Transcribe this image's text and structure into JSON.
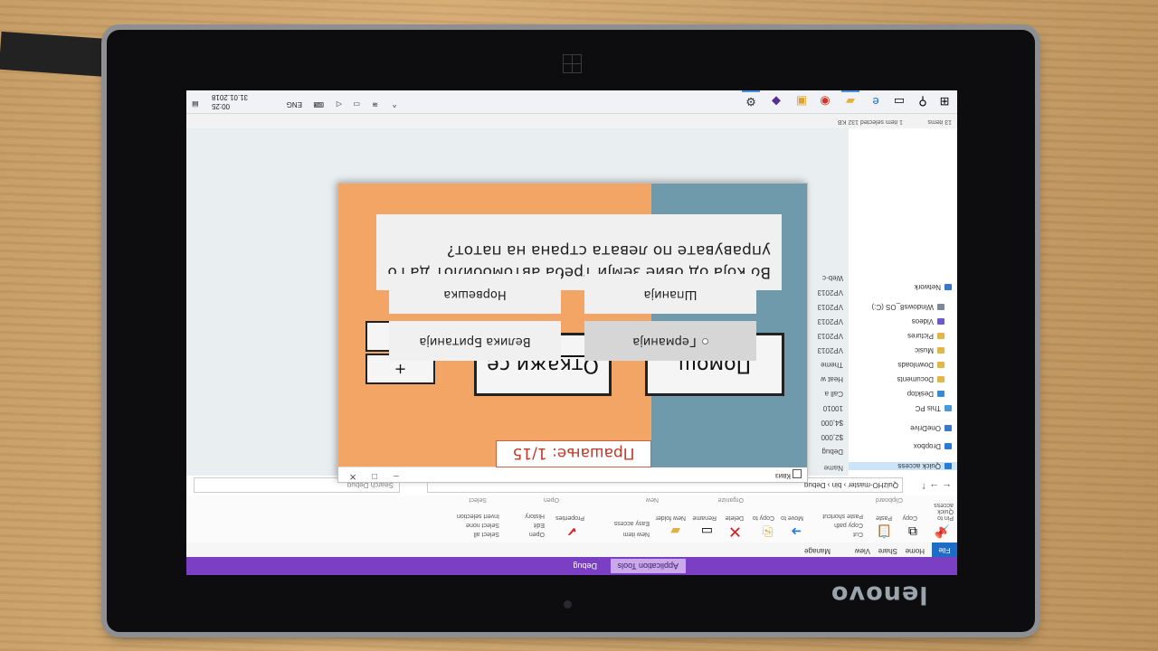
{
  "device": {
    "brand": "lenovo"
  },
  "explorer": {
    "title_tabs": [
      "Application Tools",
      "Debug"
    ],
    "ribbon_tabs": [
      "File",
      "Home",
      "Share",
      "View",
      "Manage"
    ],
    "ribbon_labels": [
      "Pin to Quick access",
      "Copy",
      "Paste",
      "Cut",
      "Copy path",
      "Paste shortcut",
      "Move to",
      "Copy to",
      "Delete",
      "Rename",
      "New folder",
      "New item",
      "Easy access",
      "Properties",
      "Open",
      "Edit",
      "History",
      "Select all",
      "Select none",
      "Invert selection"
    ],
    "ribbon_groups": [
      "Clipboard",
      "Organize",
      "New",
      "Open",
      "Select"
    ],
    "address": "QuizHO-master › bin › Debug",
    "search_placeholder": "Search Debug",
    "nav_items": [
      "Quick access",
      "Dropbox",
      "OneDrive",
      "This PC",
      "Desktop",
      "Documents",
      "Downloads",
      "Music",
      "Pictures",
      "Videos",
      "Windows8_OS (C:)",
      "Network"
    ],
    "file_header": "Name",
    "files": [
      "Debug",
      "$2,000",
      "$4,000",
      "10010",
      "Call a",
      "Heat w",
      "Theme",
      "VP2013",
      "VP2013",
      "VP2013",
      "VP2013",
      "VP2013",
      "Web-c"
    ],
    "status": "13 items",
    "status_selection": "1 item selected  132 KB"
  },
  "taskbar": {
    "tray_lang": "ENG",
    "time": "00:25",
    "date": "31.01.2018"
  },
  "quiz": {
    "window_title": "Квиз",
    "buttons": {
      "help": "Помош",
      "quit": "Откажи се",
      "plus": "+",
      "minus": "-"
    },
    "counter": "Прашање: 1/15",
    "question": "Во која од овие земји треба автомобилот да го управувате по левата страна на патот?",
    "answers": [
      "Германија",
      "Велика Британија",
      "Шпанија",
      "Норвешка"
    ]
  }
}
